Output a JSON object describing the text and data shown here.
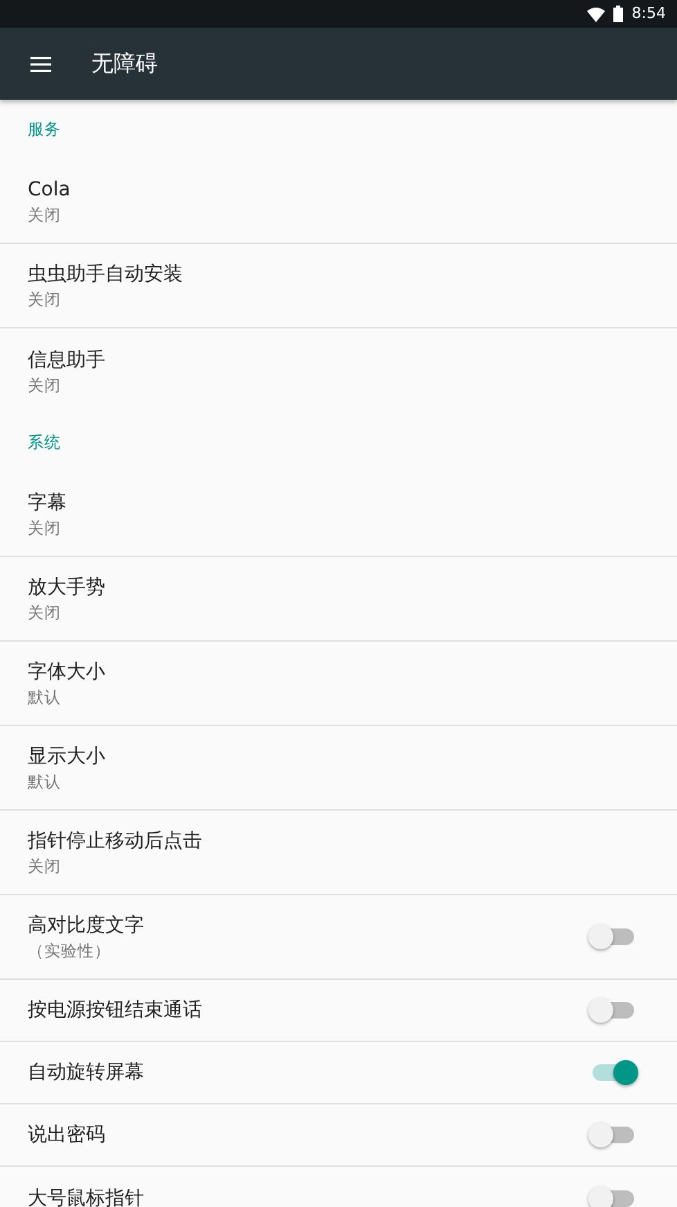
{
  "status_bar": {
    "time": "8:54"
  },
  "app_bar": {
    "title": "无障碍"
  },
  "sections": [
    {
      "header": "服务",
      "items": [
        {
          "kind": "nav",
          "title": "Cola",
          "summary": "关闭"
        },
        {
          "kind": "nav",
          "title": "虫虫助手自动安装",
          "summary": "关闭"
        },
        {
          "kind": "nav",
          "title": "信息助手",
          "summary": "关闭"
        }
      ]
    },
    {
      "header": "系统",
      "items": [
        {
          "kind": "nav",
          "title": "字幕",
          "summary": "关闭"
        },
        {
          "kind": "nav",
          "title": "放大手势",
          "summary": "关闭"
        },
        {
          "kind": "nav",
          "title": "字体大小",
          "summary": "默认"
        },
        {
          "kind": "nav",
          "title": "显示大小",
          "summary": "默认"
        },
        {
          "kind": "nav",
          "title": "指针停止移动后点击",
          "summary": "关闭"
        },
        {
          "kind": "toggle",
          "title": "高对比度文字",
          "summary": "（实验性）",
          "on": false
        },
        {
          "kind": "toggle",
          "title": "按电源按钮结束通话",
          "on": false
        },
        {
          "kind": "toggle",
          "title": "自动旋转屏幕",
          "on": true
        },
        {
          "kind": "toggle",
          "title": "说出密码",
          "on": false
        },
        {
          "kind": "toggle",
          "title": "大号鼠标指针",
          "on": false
        }
      ]
    }
  ]
}
